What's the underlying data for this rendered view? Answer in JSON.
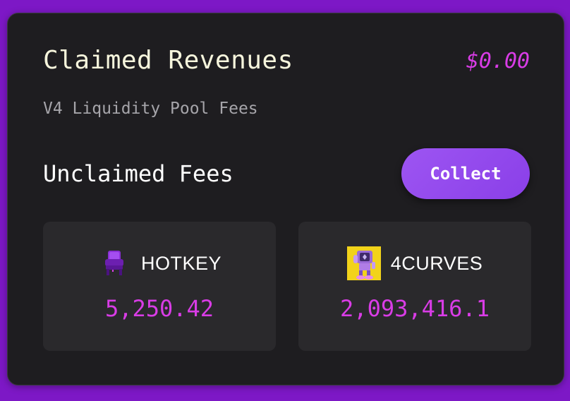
{
  "claimed": {
    "title": "Claimed Revenues",
    "total": "$0.00",
    "subtitle": "V4 Liquidity Pool Fees"
  },
  "unclaimed": {
    "title": "Unclaimed Fees",
    "collect_label": "Collect"
  },
  "tokens": [
    {
      "name": "HOTKEY",
      "amount": "5,250.42",
      "icon": "purple-chair-icon"
    },
    {
      "name": "4CURVES",
      "amount": "2,093,416.1",
      "icon": "purple-robot-on-yellow-icon"
    }
  ],
  "colors": {
    "page_background": "#7d18c6",
    "card_background": "#1e1d20",
    "token_card_background": "#2a292c",
    "accent_magenta": "#d93ce6",
    "button_purple": "#8f47ec",
    "title_cream": "#f6f5dc",
    "subtitle_gray": "#a6a5aa"
  }
}
